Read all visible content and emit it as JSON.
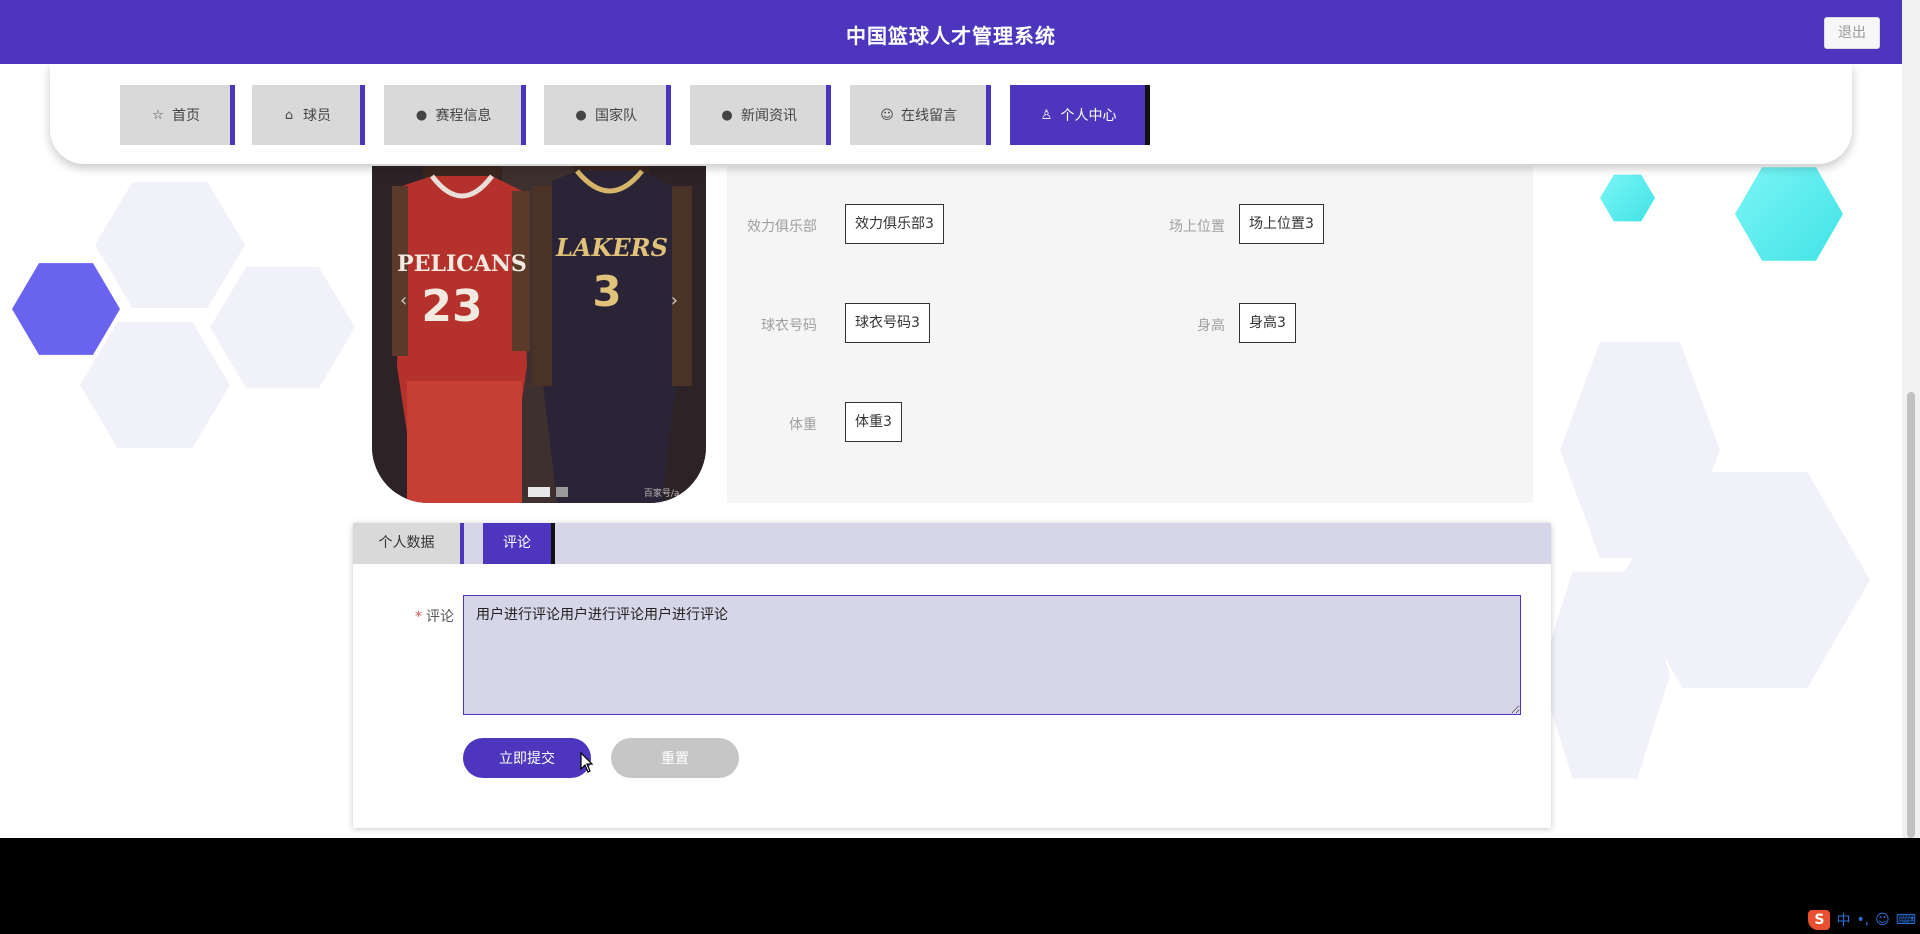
{
  "header": {
    "title": "中国篮球人才管理系统",
    "logout_label": "退出"
  },
  "nav": {
    "items": [
      {
        "label": "首页",
        "icon": "star-icon",
        "glyph": "☆"
      },
      {
        "label": "球员",
        "icon": "bag-icon",
        "glyph": "⌂"
      },
      {
        "label": "赛程信息",
        "icon": "info-circle-icon",
        "glyph": "●"
      },
      {
        "label": "国家队",
        "icon": "question-circle-icon",
        "glyph": "●"
      },
      {
        "label": "新闻资讯",
        "icon": "info-circle-icon",
        "glyph": "●"
      },
      {
        "label": "在线留言",
        "icon": "smile-icon",
        "glyph": "☺"
      },
      {
        "label": "个人中心",
        "icon": "user-icon",
        "glyph": "♙"
      }
    ],
    "active_index": 6
  },
  "player_image": {
    "watermark": "百家号/a...",
    "jersey_left_team": "PELICANS",
    "jersey_left_number": "23",
    "jersey_right_team": "LAKERS",
    "jersey_right_number": "3"
  },
  "info": {
    "club_label": "效力俱乐部",
    "club_value": "效力俱乐部3",
    "position_label": "场上位置",
    "position_value": "场上位置3",
    "jersey_label": "球衣号码",
    "jersey_value": "球衣号码3",
    "height_label": "身高",
    "height_value": "身高3",
    "weight_label": "体重",
    "weight_value": "体重3"
  },
  "tabs": {
    "personal_data": "个人数据",
    "comments": "评论"
  },
  "comment_form": {
    "required_mark": "*",
    "label": "评论",
    "value": "用户进行评论用户进行评论用户进行评论",
    "submit_label": "立即提交",
    "reset_label": "重置"
  },
  "ime": {
    "logo": "S",
    "mode": "中",
    "punct": "•,"
  },
  "colors": {
    "primary": "#4d35bd",
    "tab_bar": "#d6d6e8",
    "nav_inactive": "#d9d9d9",
    "footer": "#000000"
  }
}
